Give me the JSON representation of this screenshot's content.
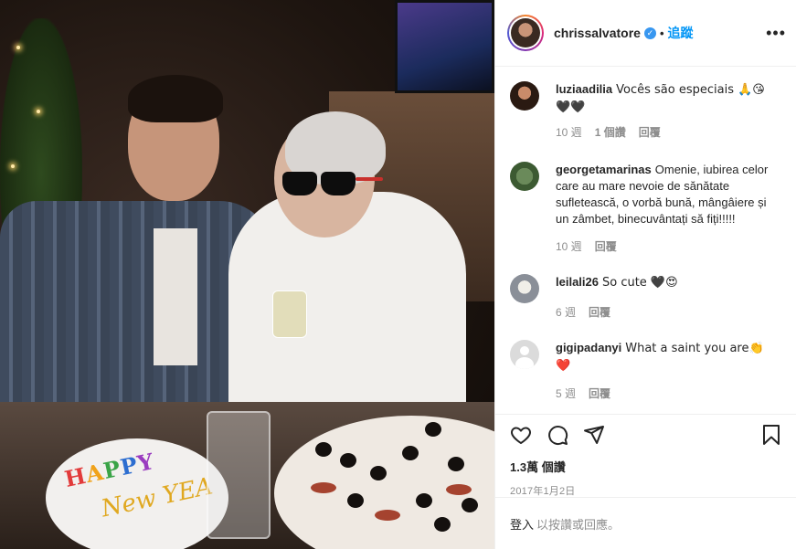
{
  "header": {
    "username": "chrissalvatore",
    "verified_symbol": "✓",
    "separator": "•",
    "follow_label": "追蹤",
    "more_label": "•••"
  },
  "comments": [
    {
      "user": "luziaadilia",
      "text": "Vocês são especiais 🙏😘",
      "text2": "🖤🖤",
      "age": "10 週",
      "likes": "1 個讚",
      "reply": "回覆"
    },
    {
      "user": "georgetamarinas",
      "text": "Omenie, iubirea celor care au mare nevoie de sănătate sufletească, o vorbă bună, mângâiere și un zâmbet, binecuvântați să fiți!!!!!",
      "age": "10 週",
      "reply": "回覆"
    },
    {
      "user": "leilali26",
      "text": "So cute 🖤😍",
      "age": "6 週",
      "reply": "回覆"
    },
    {
      "user": "gigipadanyi",
      "text": "What a saint you are👏",
      "text2": "❤️",
      "age": "5 週",
      "reply": "回覆"
    }
  ],
  "actions": {
    "like_icon": "heart-icon",
    "comment_icon": "comment-icon",
    "share_icon": "paper-plane-icon",
    "save_icon": "bookmark-icon",
    "likes_count": "1.3萬",
    "likes_unit": " 個讚",
    "date": "2017年1月2日"
  },
  "login": {
    "link": "登入",
    "suffix": "以按讚或回應。"
  },
  "photo": {
    "happy_text": "HAPPY",
    "newyear_text": "New YEA"
  },
  "colors": {
    "link_blue": "#0095f6",
    "verified_blue": "#3897f0",
    "meta_gray": "#8e8e8e",
    "text": "#262626",
    "border": "#efefef"
  }
}
